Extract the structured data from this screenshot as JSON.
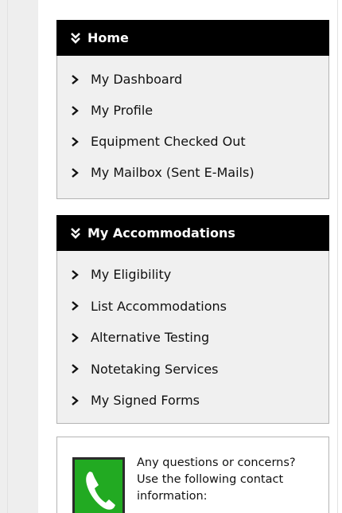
{
  "home_panel": {
    "title": "Home",
    "items": [
      {
        "label": "My Dashboard"
      },
      {
        "label": "My Profile"
      },
      {
        "label": "Equipment Checked Out"
      },
      {
        "label": "My Mailbox (Sent E-Mails)"
      }
    ]
  },
  "accommodations_panel": {
    "title": "My Accommodations",
    "items": [
      {
        "label": "My Eligibility"
      },
      {
        "label": "List Accommodations"
      },
      {
        "label": "Alternative Testing"
      },
      {
        "label": "Notetaking Services"
      },
      {
        "label": "My Signed Forms"
      }
    ]
  },
  "contact": {
    "line1": "Any questions or concerns?",
    "line2": "Use the following contact",
    "line3": "information:",
    "icon": "phone-icon",
    "icon_color": "#22aa22"
  },
  "colors": {
    "header_bg": "#000000",
    "header_text": "#ffffff",
    "panel_bg": "#f0f0f0",
    "panel_border": "#b4b4b4",
    "gutter_bg": "#eeeeee"
  }
}
